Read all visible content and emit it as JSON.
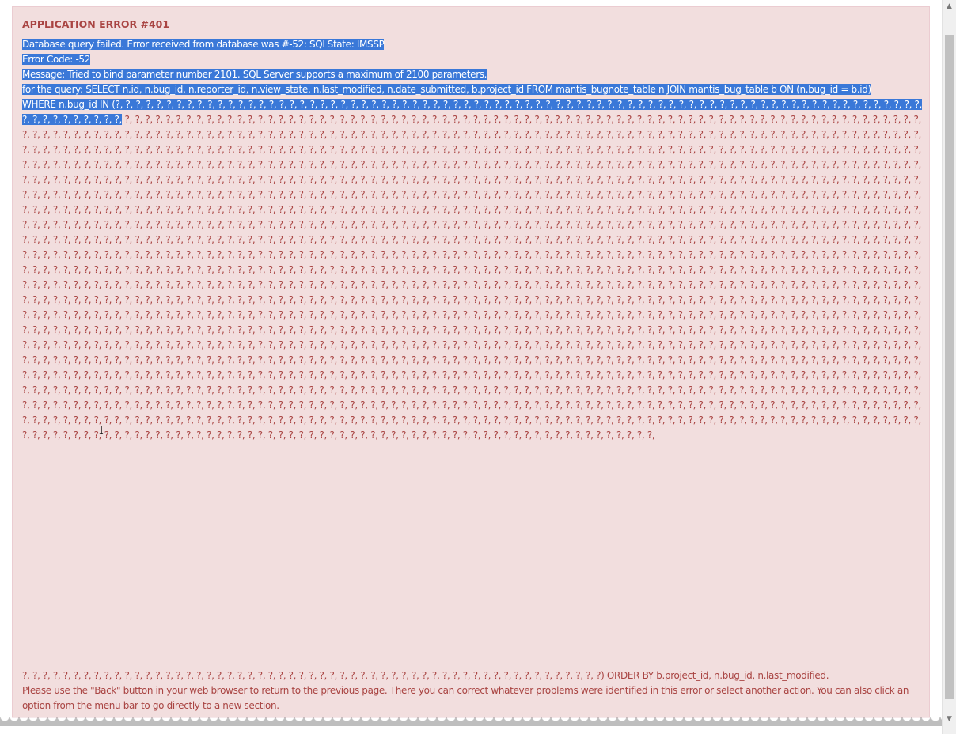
{
  "error": {
    "title": "APPLICATION ERROR #401",
    "line1": "Database query failed. Error received from database was #-52: SQLState: IMSSP",
    "line2": "Error Code: -52",
    "line3": "Message: Tried to bind parameter number 2101. SQL Server supports a maximum of 2100 parameters.",
    "line4": "for the query: SELECT n.id, n.bug_id, n.reporter_id, n.view_state, n.last_modified, n.date_submitted, b.project_id FROM mantis_bugnote_table n JOIN mantis_bug_table b ON (n.bug_id = b.id)",
    "line5_selected": "WHERE n.bug_id IN (?, ?, ?, ?, ?, ?, ?, ?, ?, ?, ?, ?, ?, ?, ?, ?, ?, ?, ?, ?, ?, ?, ?, ?, ?, ?, ?, ?, ?, ?, ?, ?, ?, ?, ?, ?, ?, ?, ?, ?, ?, ?, ?, ?, ?, ?, ?, ?, ?, ?, ?, ?, ?, ?, ?, ?, ?, ?, ?, ?, ?, ?, ?, ?, ?, ?, ?, ?, ?, ?, ?, ?, ?, ?, ?, ?, ?, ?, ?, ?, ?, ?, ?, ?, ?, ?, ?, ?, ?,",
    "placeholder_token": "?, ",
    "query_tail": "?, ?, ?, ?, ?, ?, ?, ?, ?, ?, ?, ?, ?, ?, ?, ?, ?, ?, ?, ?, ?, ?, ?, ?, ?, ?, ?, ?, ?, ?, ?, ?, ?, ?, ?, ?, ?, ?, ?, ?, ?, ?, ?, ?, ?, ?, ?, ?, ?, ?, ?, ?, ?, ?, ?, ?, ?) ORDER BY b.project_id, n.bug_id, n.last_modified.",
    "advice": "Please use the \"Back\" button in your web browser to return to the previous page. There you can correct whatever problems were identified in this error or select another action. You can also click an option from the menu bar to go directly to a new section."
  },
  "colors": {
    "alert_background": "#f2dede",
    "alert_text": "#a94442",
    "selection": "#3a78d8"
  },
  "icons": {
    "cursor": "text-cursor-icon",
    "scroll_up": "scroll-up-arrow-icon",
    "scroll_down": "scroll-down-arrow-icon"
  }
}
